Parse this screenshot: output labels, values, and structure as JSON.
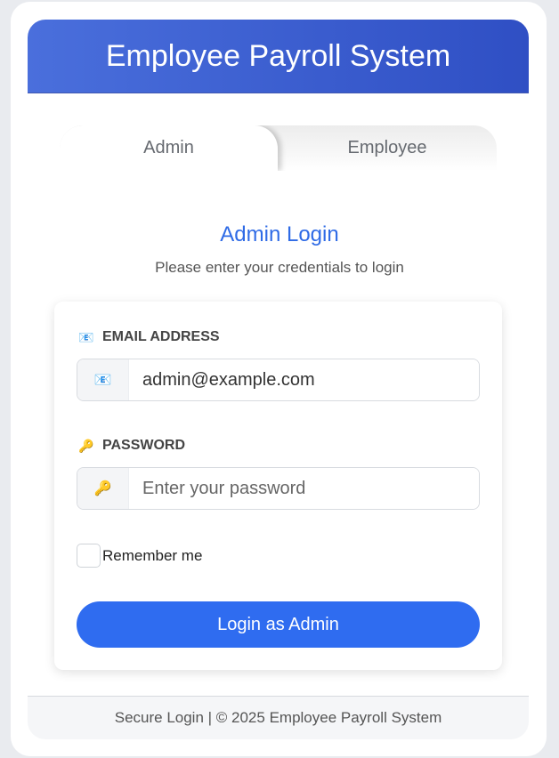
{
  "header": {
    "title": "Employee Payroll System"
  },
  "tabs": [
    {
      "label": "Admin",
      "active": true
    },
    {
      "label": "Employee",
      "active": false
    }
  ],
  "login": {
    "title": "Admin Login",
    "subtitle": "Please enter your credentials to login"
  },
  "form": {
    "email": {
      "label": "EMAIL ADDRESS",
      "icon": "email-icon",
      "value": "admin@example.com",
      "placeholder": ""
    },
    "password": {
      "label": "PASSWORD",
      "icon": "key-icon",
      "value": "",
      "placeholder": "Enter your password"
    },
    "remember_label": "Remember me",
    "remember_checked": false,
    "submit_label": "Login as Admin"
  },
  "footer": {
    "text": "Secure Login | © 2025 Employee Payroll System"
  },
  "colors": {
    "header_gradient_start": "#4a6fdc",
    "header_gradient_end": "#2f4fc4",
    "accent": "#2f6cf0",
    "title": "#2f6be6"
  }
}
